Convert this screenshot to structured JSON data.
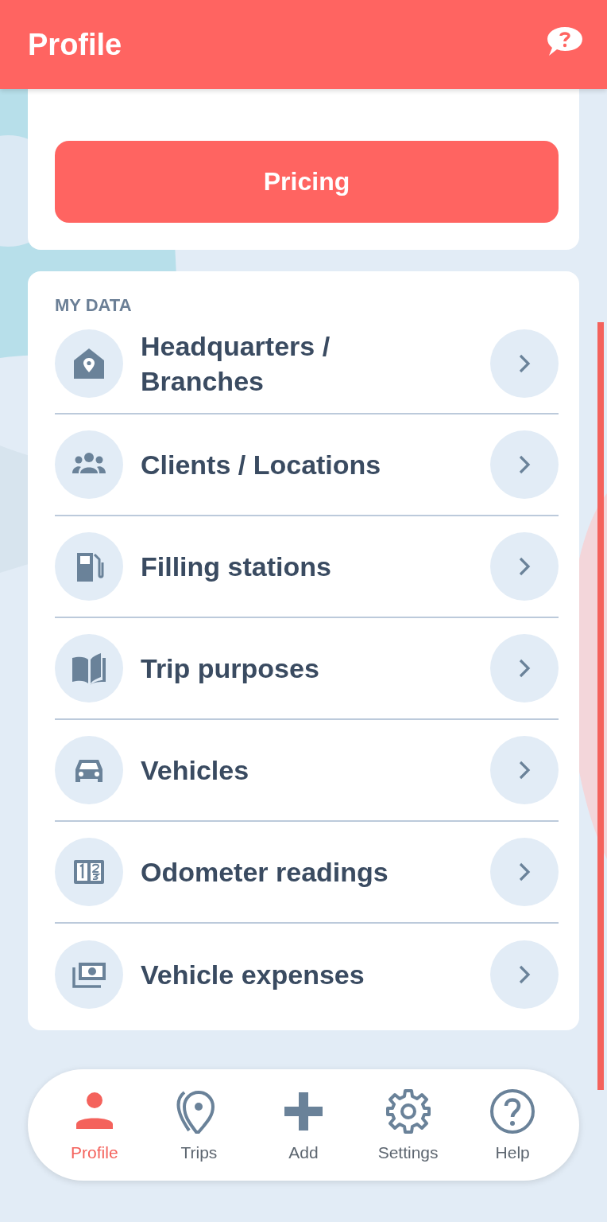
{
  "header": {
    "title": "Profile"
  },
  "pricing_button": {
    "label": "Pricing"
  },
  "my_data": {
    "heading": "MY DATA",
    "items": [
      {
        "label": "Headquarters / Branches"
      },
      {
        "label": "Clients / Locations"
      },
      {
        "label": "Filling stations"
      },
      {
        "label": "Trip purposes"
      },
      {
        "label": "Vehicles"
      },
      {
        "label": "Odometer readings"
      },
      {
        "label": "Vehicle expenses"
      }
    ]
  },
  "bottom_nav": [
    {
      "label": "Profile",
      "selected": true
    },
    {
      "label": "Trips",
      "selected": false
    },
    {
      "label": "Add",
      "selected": false
    },
    {
      "label": "Settings",
      "selected": false
    },
    {
      "label": "Help",
      "selected": false
    }
  ]
}
